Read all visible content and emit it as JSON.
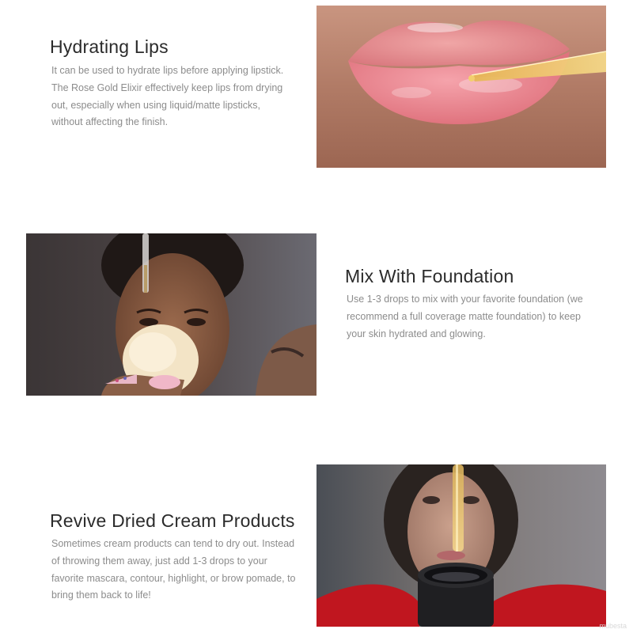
{
  "sections": [
    {
      "title": "Hydrating Lips",
      "body": "It can be used to hydrate lips before applying lipstick. The Rose Gold Elixir effectively keep lips from drying out, especially when using liquid/matte lipsticks, without affecting the finish."
    },
    {
      "title": "Mix With Foundation",
      "body": "Use 1-3 drops to mix with your favorite foundation (we recommend a full coverage matte foundation) to keep your skin hydrated and glowing."
    },
    {
      "title": "Revive Dried Cream Products",
      "body": "Sometimes cream products can tend to dry out. Instead of throwing them away, just add 1-3 drops to your favorite mascara, contour, highlight, or brow pomade, to bring them back to life!"
    }
  ],
  "watermark": "mubesta",
  "colors": {
    "title": "#2b2b2b",
    "body": "#8c8c8c",
    "background": "#ffffff"
  }
}
